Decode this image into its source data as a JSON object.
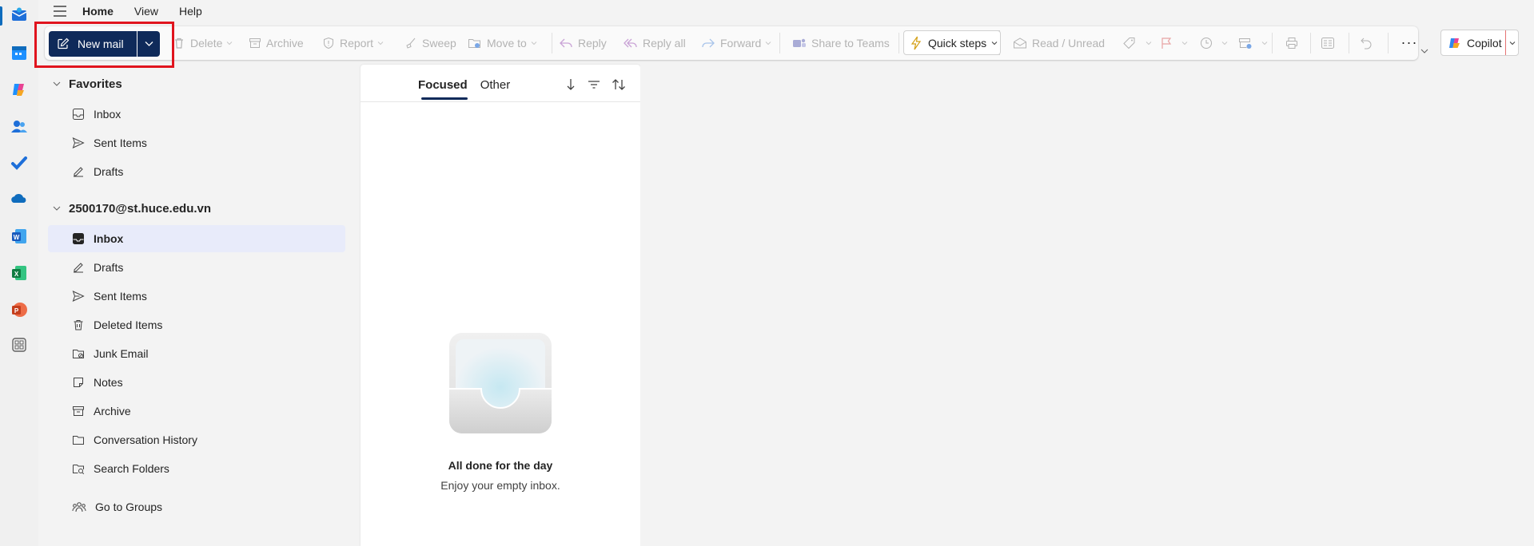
{
  "menu": {
    "tabs": [
      {
        "label": "Home",
        "active": true
      },
      {
        "label": "View",
        "active": false
      },
      {
        "label": "Help",
        "active": false
      }
    ]
  },
  "rail": {
    "apps": [
      "mail-icon",
      "calendar-icon",
      "copilot-app-icon",
      "people-icon",
      "todo-icon",
      "onedrive-icon",
      "word-icon",
      "excel-icon",
      "powerpoint-icon",
      "more-apps-icon"
    ]
  },
  "ribbon": {
    "new_mail": "New mail",
    "delete": "Delete",
    "archive": "Archive",
    "report": "Report",
    "sweep": "Sweep",
    "move_to": "Move to",
    "reply": "Reply",
    "reply_all": "Reply all",
    "forward": "Forward",
    "share_to_teams": "Share to Teams",
    "quick_steps": "Quick steps",
    "read_unread": "Read / Unread",
    "more": "···",
    "copilot": "Copilot"
  },
  "favorites": {
    "title": "Favorites",
    "items": [
      {
        "label": "Inbox",
        "icon": "inbox-icon"
      },
      {
        "label": "Sent Items",
        "icon": "send-icon"
      },
      {
        "label": "Drafts",
        "icon": "drafts-icon"
      }
    ]
  },
  "account": {
    "title": "2500170@st.huce.edu.vn",
    "items": [
      {
        "label": "Inbox",
        "icon": "inbox-icon",
        "selected": true
      },
      {
        "label": "Drafts",
        "icon": "drafts-icon"
      },
      {
        "label": "Sent Items",
        "icon": "send-icon"
      },
      {
        "label": "Deleted Items",
        "icon": "trash-icon"
      },
      {
        "label": "Junk Email",
        "icon": "junk-icon"
      },
      {
        "label": "Notes",
        "icon": "note-icon"
      },
      {
        "label": "Archive",
        "icon": "archive-icon"
      },
      {
        "label": "Conversation History",
        "icon": "folder-icon"
      },
      {
        "label": "Search Folders",
        "icon": "search-folder-icon"
      }
    ],
    "go_to_groups": "Go to Groups"
  },
  "message_list": {
    "tabs": [
      {
        "label": "Focused",
        "active": true
      },
      {
        "label": "Other",
        "active": false
      }
    ],
    "empty_title": "All done for the day",
    "empty_subtitle": "Enjoy your empty inbox."
  },
  "colors": {
    "accent": "#0f6cbd",
    "new_mail_bg": "#0f2a5a",
    "highlight": "#e0141e",
    "selected_folder": "#e8ebfa"
  }
}
